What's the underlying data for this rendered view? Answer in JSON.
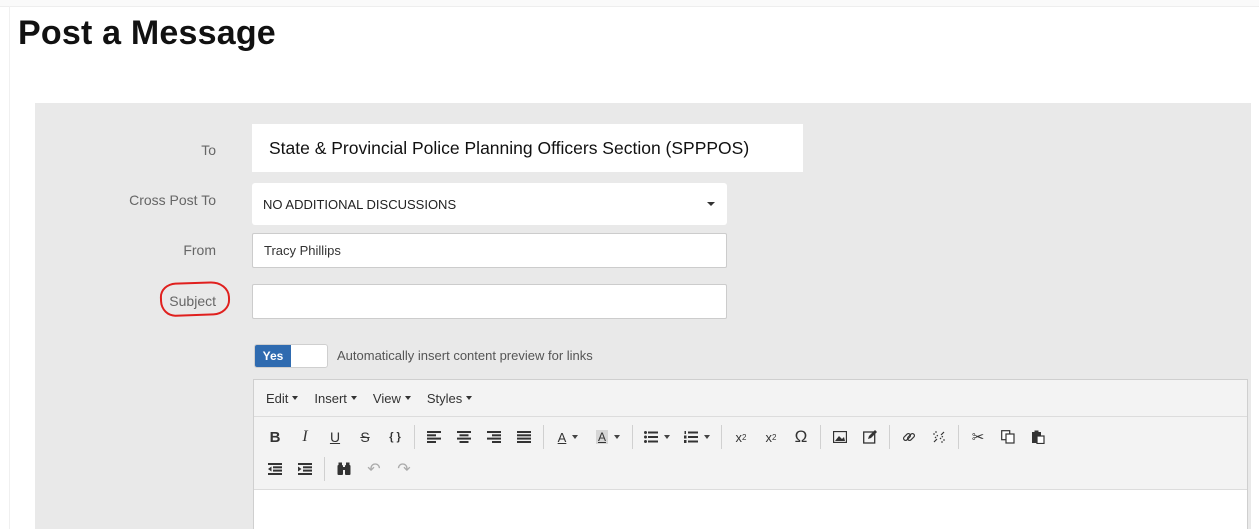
{
  "page": {
    "title": "Post a Message"
  },
  "form": {
    "to_label": "To",
    "to_value": "State & Provincial Police Planning Officers Section (SPPPOS)",
    "cross_post_label": "Cross Post To",
    "cross_post_value": "NO ADDITIONAL DISCUSSIONS",
    "from_label": "From",
    "from_value": "Tracy Phillips",
    "subject_label": "Subject",
    "subject_value": ""
  },
  "toggle": {
    "state": "Yes",
    "label": "Automatically insert content preview for links"
  },
  "editor": {
    "menus": [
      "Edit",
      "Insert",
      "View",
      "Styles"
    ],
    "toolbar_row1": [
      "bold-icon",
      "italic-icon",
      "underline-icon",
      "strikethrough-icon",
      "source-code-icon",
      "align-left-icon",
      "align-center-icon",
      "align-right-icon",
      "align-justify-icon",
      "text-color-icon",
      "background-color-icon",
      "bullet-list-icon",
      "numbered-list-icon",
      "subscript-icon",
      "superscript-icon",
      "special-character-icon",
      "image-icon",
      "edit-image-icon",
      "link-icon",
      "unlink-icon",
      "cut-icon",
      "copy-icon",
      "paste-icon"
    ],
    "toolbar_row2": [
      "outdent-icon",
      "indent-icon",
      "find-icon",
      "undo-icon",
      "redo-icon"
    ]
  },
  "colors": {
    "accent": "#2f6bb0",
    "annotation": "#e0201e",
    "panel": "#e9e9e9"
  }
}
